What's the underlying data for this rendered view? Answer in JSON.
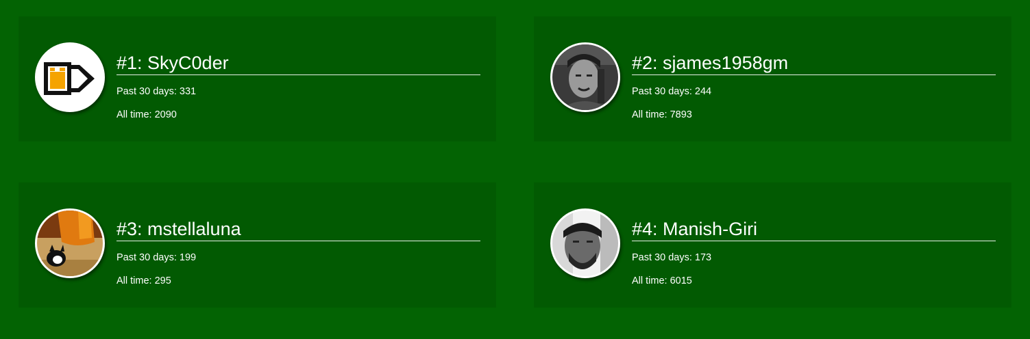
{
  "leaderboard": [
    {
      "title": "#1: SkyC0der",
      "past_30_days": "Past 30 days: 331",
      "all_time": "All time: 2090",
      "avatar_icon": "beer-mug-logo-icon"
    },
    {
      "title": "#2: sjames1958gm",
      "past_30_days": "Past 30 days: 244",
      "all_time": "All time: 7893",
      "avatar_icon": "samurai-portrait-photo"
    },
    {
      "title": "#3: mstellaluna",
      "past_30_days": "Past 30 days: 199",
      "all_time": "All time: 295",
      "avatar_icon": "cartoon-cat-photo"
    },
    {
      "title": "#4: Manish-Giri",
      "past_30_days": "Past 30 days: 173",
      "all_time": "All time: 6015",
      "avatar_icon": "man-portrait-photo"
    }
  ],
  "colors": {
    "background": "#036303",
    "card": "#025a02",
    "text": "#ffffff",
    "accent_orange": "#f5a300"
  }
}
